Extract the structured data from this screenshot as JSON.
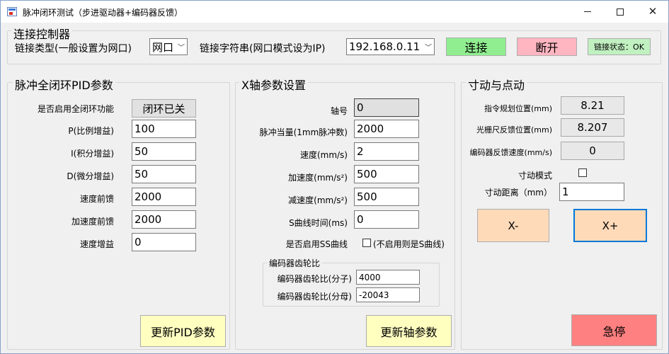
{
  "window": {
    "title": "脉冲闭环测试（步进驱动器+编码器反馈）"
  },
  "connection": {
    "group_title": "连接控制器",
    "type_label": "链接类型(一般设置为网口)",
    "type_value": "网口",
    "conn_string_label": "链接字符串(网口模式设为IP)",
    "conn_string_value": "192.168.0.11",
    "connect_label": "连接",
    "disconnect_label": "断开",
    "status_text": "链接状态：OK"
  },
  "pid": {
    "group_title": "脉冲全闭环PID参数",
    "enable_label": "是否启用全闭环功能",
    "toggle_label": "闭环已关",
    "p_label": "P(比例增益)",
    "p_value": "100",
    "i_label": "I(积分增益)",
    "i_value": "50",
    "d_label": "D(微分增益)",
    "d_value": "50",
    "vff_label": "速度前馈",
    "vff_value": "2000",
    "aff_label": "加速度前馈",
    "aff_value": "2000",
    "vgain_label": "速度增益",
    "vgain_value": "0",
    "update_label": "更新PID参数"
  },
  "axis": {
    "group_title": "X轴参数设置",
    "axis_no_label": "轴号",
    "axis_no_value": "0",
    "units_label": "脉冲当量(1mm脉冲数)",
    "units_value": "2000",
    "speed_label": "速度(mm/s)",
    "speed_value": "2",
    "accel_label": "加速度(mm/s²)",
    "accel_value": "500",
    "decel_label": "减速度(mm/s²)",
    "decel_value": "500",
    "scurve_label": "S曲线时间(ms)",
    "scurve_value": "0",
    "ss_enable_label": "是否启用SS曲线",
    "ss_note": "(不启用则是S曲线)",
    "gear_group_title": "编码器齿轮比",
    "gear_num_label": "编码器齿轮比(分子)",
    "gear_num_value": "4000",
    "gear_den_label": "编码器齿轮比(分母)",
    "gear_den_value": "-20043",
    "update_label": "更新轴参数"
  },
  "jog": {
    "group_title": "寸动与点动",
    "cmd_pos_label": "指令规划位置(mm)",
    "cmd_pos_value": "8.21",
    "scale_pos_label": "光栅尺反馈位置(mm)",
    "scale_pos_value": "8.207",
    "enc_speed_label": "编码器反馈速度(mm/s)",
    "enc_speed_value": "0",
    "inch_mode_label": "寸动模式",
    "inch_dist_label": "寸动距离（mm）",
    "inch_dist_value": "1",
    "minus_label": "X-",
    "plus_label": "X+",
    "estop_label": "急停"
  },
  "colors": {
    "connect_bg": "#90ee90",
    "disconnect_bg": "#ffb6c1",
    "status_bg": "#c1f0c1",
    "update_bg": "#ffffc0",
    "jog_bg": "#ffdab9",
    "estop_bg": "#ff8080",
    "focus_border": "#0078d7"
  }
}
